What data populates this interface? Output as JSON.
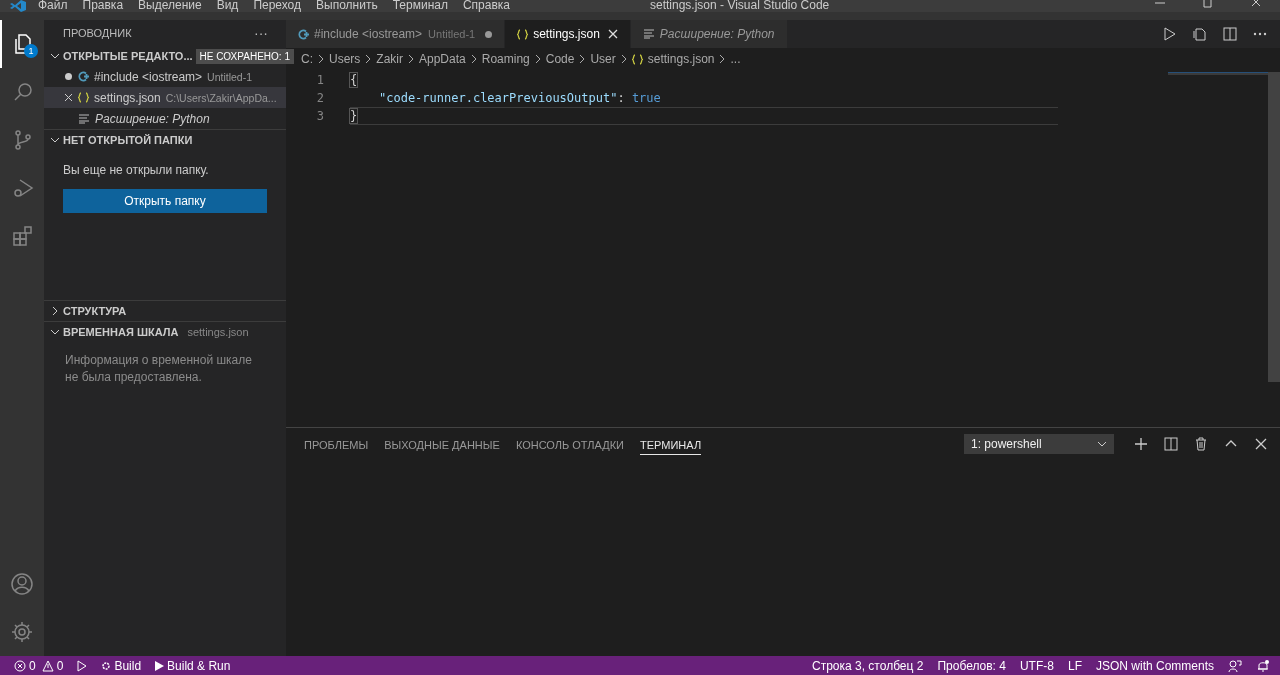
{
  "menu": [
    "Файл",
    "Правка",
    "Выделение",
    "Вид",
    "Переход",
    "Выполнить",
    "Терминал",
    "Справка"
  ],
  "window": {
    "title": "settings.json - Visual Studio Code"
  },
  "activity_bar": [
    {
      "kind": "explorer",
      "selected": true,
      "badge": "1"
    },
    {
      "kind": "search",
      "selected": false
    },
    {
      "kind": "source-control",
      "selected": false
    },
    {
      "kind": "run",
      "selected": false
    },
    {
      "kind": "extensions",
      "selected": false
    }
  ],
  "sidebar": {
    "title": "ПРОВОДНИК",
    "more": "···",
    "open_editors": {
      "header": "ОТКРЫТЫЕ РЕДАКТО...",
      "badge": "НЕ СОХРАНЕНО: 1",
      "expanded": true,
      "items": [
        {
          "kind": "cpp",
          "name": "#include <iostream>",
          "detail": "Untitled-1",
          "dirty": true,
          "selected": false,
          "preview": false
        },
        {
          "kind": "json",
          "name": "settings.json",
          "detail": "C:\\Users\\Zakir\\AppDa...",
          "dirty": false,
          "selected": true,
          "preview": false
        },
        {
          "kind": "doc",
          "name": "Расширение: Python",
          "dirty": false,
          "selected": false,
          "preview": true
        }
      ]
    },
    "no_folder": {
      "header": "НЕТ ОТКРЫТОЙ ПАПКИ",
      "expanded": true,
      "message": "Вы еще не открыли папку.",
      "button": "Открыть папку"
    },
    "outline": {
      "header": "СТРУКТУРА",
      "expanded": false
    },
    "timeline": {
      "header": "ВРЕМЕННАЯ ШКАЛА",
      "detail": "settings.json",
      "expanded": true,
      "message": "Информация о временной шкале не была предоставлена."
    }
  },
  "tabs": [
    {
      "kind": "cpp",
      "label": "#include <iostream>",
      "detail": "Untitled-1",
      "dirty": true,
      "selected": false,
      "preview": false
    },
    {
      "kind": "json",
      "label": "settings.json",
      "dirty": false,
      "selected": true,
      "preview": false
    },
    {
      "kind": "doc",
      "label": "Расширение: Python",
      "dirty": false,
      "selected": false,
      "preview": true
    }
  ],
  "breadcrumbs": [
    {
      "kind": "folder",
      "label": "C:"
    },
    {
      "kind": "folder",
      "label": "Users"
    },
    {
      "kind": "folder",
      "label": "Zakir"
    },
    {
      "kind": "folder",
      "label": "AppData"
    },
    {
      "kind": "folder",
      "label": "Roaming"
    },
    {
      "kind": "folder",
      "label": "Code"
    },
    {
      "kind": "folder",
      "label": "User"
    },
    {
      "kind": "json",
      "label": "settings.json"
    },
    {
      "kind": "folder",
      "label": "..."
    }
  ],
  "code": [
    {
      "number": "1",
      "current": false,
      "tokens": [
        {
          "kind": "bracket",
          "text": "{"
        }
      ]
    },
    {
      "number": "2",
      "current": false,
      "indented": true,
      "tokens": [
        {
          "kind": "string",
          "text": "\"code-runner.clearPreviousOutput\""
        },
        {
          "kind": "punct",
          "text": ": "
        },
        {
          "kind": "keyword",
          "text": "true"
        }
      ]
    },
    {
      "number": "3",
      "current": true,
      "tokens": [
        {
          "kind": "bracket",
          "text": "}"
        }
      ]
    }
  ],
  "panel": {
    "tabs": [
      {
        "label": "ПРОБЛЕМЫ",
        "selected": false
      },
      {
        "label": "ВЫХОДНЫЕ ДАННЫЕ",
        "selected": false
      },
      {
        "label": "КОНСОЛЬ ОТЛАДКИ",
        "selected": false
      },
      {
        "label": "ТЕРМИНАЛ",
        "selected": true
      }
    ],
    "terminal_select": "1: powershell"
  },
  "status_bar": {
    "left": [
      {
        "kind": "errors",
        "text": "0"
      },
      {
        "kind": "warnings",
        "text": "0"
      },
      {
        "kind": "run"
      },
      {
        "kind": "gear",
        "text": "Build"
      },
      {
        "kind": "play",
        "text": "Build & Run"
      }
    ],
    "right": [
      {
        "kind": "text",
        "text": "Строка 3, столбец 2"
      },
      {
        "kind": "text",
        "text": "Пробелов: 4"
      },
      {
        "kind": "text",
        "text": "UTF-8"
      },
      {
        "kind": "text",
        "text": "LF"
      },
      {
        "kind": "text",
        "text": "JSON with Comments"
      },
      {
        "kind": "feedback"
      },
      {
        "kind": "bell"
      }
    ]
  }
}
